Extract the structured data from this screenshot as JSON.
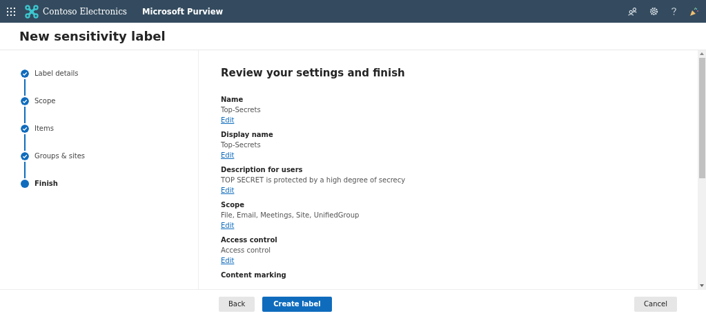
{
  "header": {
    "org": "Contoso Electronics",
    "app": "Microsoft Purview"
  },
  "page_title": "New sensitivity label",
  "steps": [
    {
      "label": "Label details",
      "selected": false
    },
    {
      "label": "Scope",
      "selected": false
    },
    {
      "label": "Items",
      "selected": false
    },
    {
      "label": "Groups & sites",
      "selected": false
    },
    {
      "label": "Finish",
      "selected": true
    }
  ],
  "review": {
    "heading": "Review your settings and finish",
    "sections": [
      {
        "label": "Name",
        "value": "Top-Secrets",
        "link": "Edit"
      },
      {
        "label": "Display name",
        "value": "Top-Secrets",
        "link": "Edit"
      },
      {
        "label": "Description for users",
        "value": "TOP SECRET is protected by a high degree of secrecy",
        "link": "Edit"
      },
      {
        "label": "Scope",
        "value": "File, Email, Meetings, Site, UnifiedGroup",
        "link": "Edit"
      },
      {
        "label": "Access control",
        "value": "Access control",
        "link": "Edit"
      },
      {
        "label": "Content marking"
      }
    ]
  },
  "footer": {
    "back": "Back",
    "create": "Create label",
    "cancel": "Cancel"
  }
}
